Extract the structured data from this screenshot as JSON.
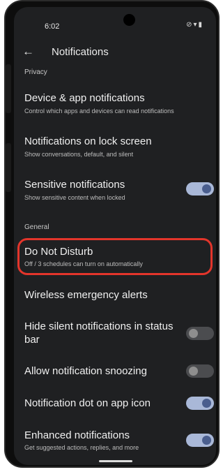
{
  "status_bar": {
    "time": "6:02",
    "icons": "⊘ ▾ ▮"
  },
  "app_bar": {
    "back_icon": "arrow-left-icon",
    "title": "Notifications"
  },
  "sections": {
    "privacy": "Privacy",
    "general": "General"
  },
  "items": {
    "device_app": {
      "title": "Device & app notifications",
      "subtitle": "Control which apps and devices can read notifications"
    },
    "lock_screen": {
      "title": "Notifications on lock screen",
      "subtitle": "Show conversations, default, and silent"
    },
    "sensitive": {
      "title": "Sensitive notifications",
      "subtitle": "Show sensitive content when locked",
      "toggle_on": true
    },
    "dnd": {
      "title": "Do Not Disturb",
      "subtitle": "Off / 3 schedules can turn on automatically"
    },
    "wireless": {
      "title": "Wireless emergency alerts"
    },
    "hide_silent": {
      "title": "Hide silent notifications in status bar",
      "toggle_on": false
    },
    "snoozing": {
      "title": "Allow notification snoozing",
      "toggle_on": false
    },
    "dot": {
      "title": "Notification dot on app icon",
      "toggle_on": true
    },
    "enhanced": {
      "title": "Enhanced notifications",
      "subtitle": "Get suggested actions, replies, and more",
      "toggle_on": true
    }
  },
  "colors": {
    "background": "#1f2022",
    "toggle_on_track": "#a9b8d8",
    "toggle_off_track": "#4b4c4f",
    "highlight": "#e3352b"
  }
}
